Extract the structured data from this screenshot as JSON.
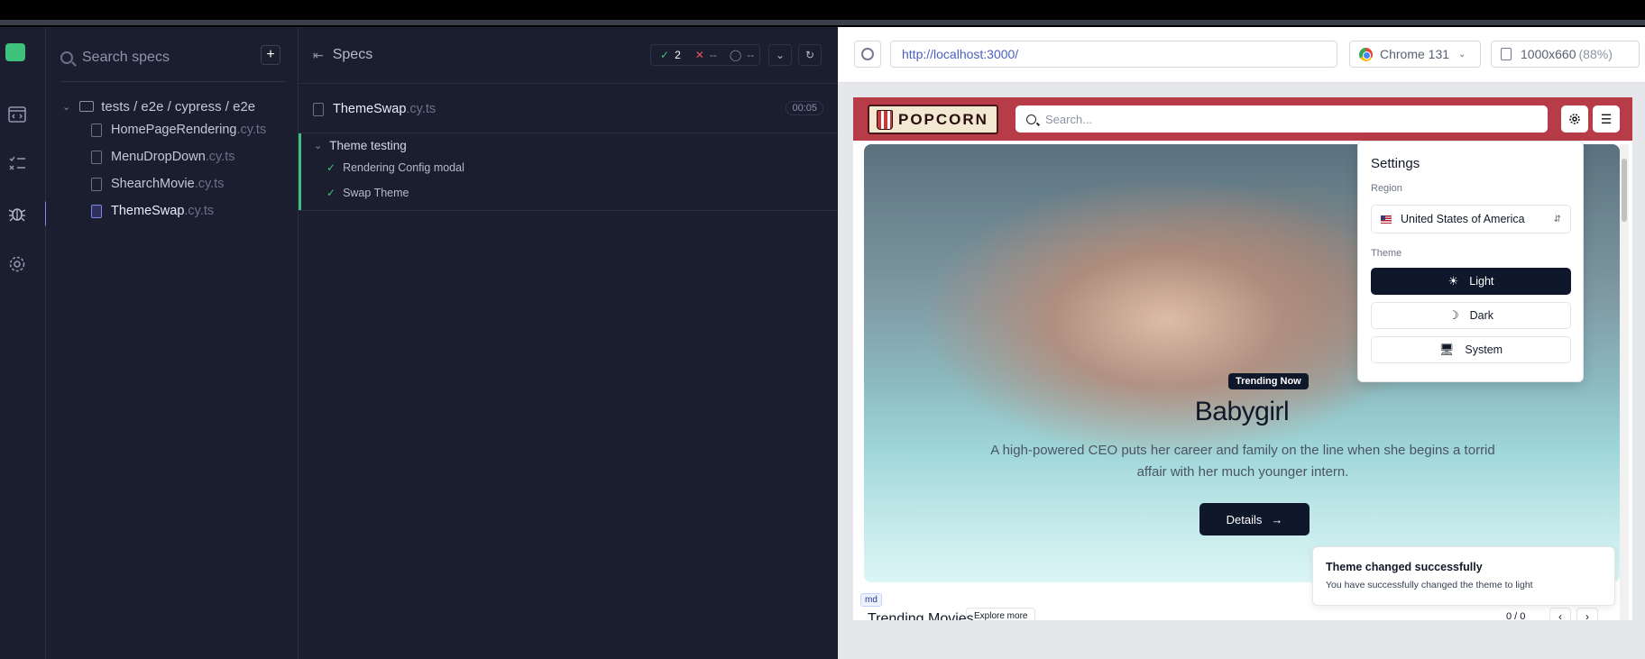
{
  "specs_panel": {
    "search_placeholder": "Search specs",
    "add_label": "+",
    "folder_path": "tests / e2e / cypress / e2e",
    "files": [
      {
        "name": "HomePageRendering",
        "ext": ".cy.ts"
      },
      {
        "name": "MenuDropDown",
        "ext": ".cy.ts"
      },
      {
        "name": "ShearchMovie",
        "ext": ".cy.ts"
      },
      {
        "name": "ThemeSwap",
        "ext": ".cy.ts"
      }
    ]
  },
  "reporter": {
    "title": "Specs",
    "passed": "2",
    "failed": "--",
    "pending": "--",
    "spec_name": "ThemeSwap",
    "spec_ext": ".cy.ts",
    "duration": "00:05",
    "suite": "Theme testing",
    "tests": [
      "Rendering Config modal",
      "Swap Theme"
    ]
  },
  "browser": {
    "url": "http://localhost:3000/",
    "browser_name": "Chrome 131",
    "viewport": "1000x660",
    "zoom": "(88%)"
  },
  "app": {
    "brand": "POPCORN",
    "search_placeholder": "Search...",
    "hero": {
      "badge": "Trending Now",
      "title": "Babygirl",
      "description": "A high-powered CEO puts her career and family on the line when she begins a torrid affair with her much younger intern.",
      "cta": "Details"
    },
    "settings": {
      "title": "Settings",
      "region_label": "Region",
      "region_value": "United States of America",
      "theme_label": "Theme",
      "theme_options": [
        "Light",
        "Dark",
        "System"
      ],
      "selected_theme": "Light"
    },
    "section": {
      "breakpoint_badge": "md",
      "title": "Trending Movies",
      "explore": "Explore more",
      "pager": "0 / 0"
    }
  },
  "toast": {
    "title": "Theme changed successfully",
    "message": "You have successfully changed the theme to light"
  },
  "colors": {
    "pass": "#3ec17a",
    "fail": "#e4535f",
    "accent": "#7f86e8",
    "nav_red": "#b83c48",
    "dark_button": "#0f172a"
  }
}
